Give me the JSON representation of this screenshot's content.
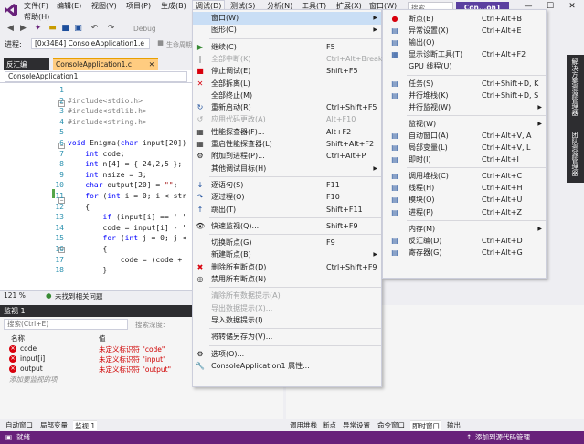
{
  "menubar": {
    "items": [
      {
        "label": "文件(F)"
      },
      {
        "label": "编辑(E)"
      },
      {
        "label": "视图(V)"
      },
      {
        "label": "项目(P)"
      },
      {
        "label": "生成(B)"
      },
      {
        "label": "调试(D)"
      },
      {
        "label": "测试(S)"
      },
      {
        "label": "分析(N)"
      },
      {
        "label": "工具(T)"
      },
      {
        "label": "扩展(X)"
      },
      {
        "label": "窗口(W)"
      }
    ],
    "help": "帮助(H)",
    "search_placeholder": "搜索...",
    "project_badge": "Con...on1"
  },
  "toolbar": {
    "debug_label": "Debug",
    "process_label": "进程:",
    "process_value": "[0x34E4] ConsoleApplication1.e",
    "lifecycle_label": "生命周期"
  },
  "editor": {
    "tab_inactive": "反汇编",
    "tab_active": "ConsoleApplication1.c",
    "scope": "ConsoleApplication1",
    "lines": [
      {
        "n": "1",
        "t": ""
      },
      {
        "n": "2",
        "t": "#include<stdio.h>"
      },
      {
        "n": "3",
        "t": "#include<stdlib.h>"
      },
      {
        "n": "4",
        "t": "#include<string.h>"
      },
      {
        "n": "5",
        "t": ""
      },
      {
        "n": "6",
        "t": "void Enigma(char input[20])"
      },
      {
        "n": "7",
        "t": "    int code;"
      },
      {
        "n": "8",
        "t": "    int n[4] = { 24,2,5 };"
      },
      {
        "n": "9",
        "t": "    int nsize = 3;"
      },
      {
        "n": "10",
        "t": "    char output[20] = \"\";"
      },
      {
        "n": "11",
        "t": "    for (int i = 0; i < str"
      },
      {
        "n": "12",
        "t": "    {"
      },
      {
        "n": "13",
        "t": "        if (input[i] == ' '"
      },
      {
        "n": "14",
        "t": "        code = input[i] - '"
      },
      {
        "n": "15",
        "t": "        for (int j = 0; j <"
      },
      {
        "n": "16",
        "t": "        {"
      },
      {
        "n": "17",
        "t": "            code = (code +"
      },
      {
        "n": "18",
        "t": "        }"
      }
    ],
    "zoom": "121 %",
    "issues": "未找到相关问题"
  },
  "locals": {
    "title": "监视 1",
    "search_placeholder": "搜索(Ctrl+E)",
    "search_depth_label": "搜索深度:",
    "col_name": "名称",
    "col_value": "值",
    "rows": [
      {
        "name": "code",
        "value": "未定义标识符 \"code\""
      },
      {
        "name": "input[i]",
        "value": "未定义标识符 \"input\""
      },
      {
        "name": "output",
        "value": "未定义标识符 \"output\""
      }
    ],
    "add_watch": "添加要监视的项"
  },
  "bottom_tabs_left": [
    "自动窗口",
    "局部变量",
    "监视 1"
  ],
  "bottom_tabs_right": [
    "调用堆栈",
    "断点",
    "异常设置",
    "命令窗口",
    "即时窗口",
    "输出"
  ],
  "status": {
    "left": "就绪",
    "right": "添加到源代码管理"
  },
  "right_tabs": [
    "解决方案资源管理器",
    "团队资源管理器"
  ],
  "debug_menu": {
    "items": [
      {
        "icon": "",
        "label": "窗口(W)",
        "shortcut": "",
        "arrow": true,
        "disabled": false,
        "highlight": true
      },
      {
        "icon": "",
        "label": "图形(C)",
        "shortcut": "",
        "arrow": true,
        "disabled": false
      },
      {
        "sep": true
      },
      {
        "icon": "▶",
        "label": "继续(C)",
        "shortcut": "F5",
        "disabled": false
      },
      {
        "icon": "‖",
        "label": "全部中断(K)",
        "shortcut": "Ctrl+Alt+Break",
        "disabled": true
      },
      {
        "icon": "■",
        "label": "停止调试(E)",
        "shortcut": "Shift+F5",
        "disabled": false
      },
      {
        "icon": "✕",
        "label": "全部拆离(L)",
        "shortcut": "",
        "disabled": false
      },
      {
        "icon": "",
        "label": "全部终止(M)",
        "shortcut": "",
        "disabled": false
      },
      {
        "icon": "↻",
        "label": "重新启动(R)",
        "shortcut": "Ctrl+Shift+F5",
        "disabled": false
      },
      {
        "icon": "↺",
        "label": "应用代码更改(A)",
        "shortcut": "Alt+F10",
        "disabled": true
      },
      {
        "icon": "▦",
        "label": "性能探查器(F)...",
        "shortcut": "Alt+F2",
        "disabled": false
      },
      {
        "icon": "▦",
        "label": "重启性能探查器(L)",
        "shortcut": "Shift+Alt+F2",
        "disabled": false
      },
      {
        "icon": "⚙",
        "label": "附加到进程(P)...",
        "shortcut": "Ctrl+Alt+P",
        "disabled": false
      },
      {
        "icon": "",
        "label": "其他调试目标(H)",
        "shortcut": "",
        "arrow": true,
        "disabled": false
      },
      {
        "sep": true
      },
      {
        "icon": "↓",
        "label": "逐语句(S)",
        "shortcut": "F11",
        "disabled": false
      },
      {
        "icon": "↷",
        "label": "逐过程(O)",
        "shortcut": "F10",
        "disabled": false
      },
      {
        "icon": "↑",
        "label": "跳出(T)",
        "shortcut": "Shift+F11",
        "disabled": false
      },
      {
        "sep": true
      },
      {
        "icon": "👁",
        "label": "快速监视(Q)...",
        "shortcut": "Shift+F9",
        "disabled": false
      },
      {
        "sep": true
      },
      {
        "icon": "",
        "label": "切换断点(G)",
        "shortcut": "F9",
        "disabled": false
      },
      {
        "icon": "",
        "label": "新建断点(B)",
        "shortcut": "",
        "arrow": true,
        "disabled": false
      },
      {
        "icon": "✖",
        "label": "删除所有断点(D)",
        "shortcut": "Ctrl+Shift+F9",
        "disabled": false
      },
      {
        "icon": "◎",
        "label": "禁用所有断点(N)",
        "shortcut": "",
        "disabled": false
      },
      {
        "sep": true
      },
      {
        "icon": "",
        "label": "清除所有数据提示(A)",
        "shortcut": "",
        "disabled": true
      },
      {
        "icon": "",
        "label": "导出数据提示(X)...",
        "shortcut": "",
        "disabled": true
      },
      {
        "icon": "",
        "label": "导入数据提示(I)...",
        "shortcut": "",
        "disabled": false
      },
      {
        "sep": true
      },
      {
        "icon": "",
        "label": "将转储另存为(V)...",
        "shortcut": "",
        "disabled": false
      },
      {
        "sep": true
      },
      {
        "icon": "⚙",
        "label": "选项(O)...",
        "shortcut": "",
        "disabled": false
      },
      {
        "icon": "🔧",
        "label": "ConsoleApplication1 属性...",
        "shortcut": "",
        "disabled": false
      }
    ]
  },
  "window_menu": {
    "items": [
      {
        "icon": "●",
        "label": "断点(B)",
        "shortcut": "Ctrl+Alt+B",
        "color": "#d8000c"
      },
      {
        "icon": "▤",
        "label": "异常设置(X)",
        "shortcut": "Ctrl+Alt+E"
      },
      {
        "icon": "▤",
        "label": "输出(O)",
        "shortcut": ""
      },
      {
        "icon": "▦",
        "label": "显示诊断工具(T)",
        "shortcut": "Ctrl+Alt+F2"
      },
      {
        "icon": "",
        "label": "GPU 线程(U)",
        "shortcut": ""
      },
      {
        "sep": true
      },
      {
        "icon": "▤",
        "label": "任务(S)",
        "shortcut": "Ctrl+Shift+D, K"
      },
      {
        "icon": "▤",
        "label": "并行堆栈(K)",
        "shortcut": "Ctrl+Shift+D, S"
      },
      {
        "icon": "",
        "label": "并行监视(W)",
        "shortcut": "",
        "arrow": true
      },
      {
        "sep": true
      },
      {
        "icon": "",
        "label": "监视(W)",
        "shortcut": "",
        "arrow": true
      },
      {
        "icon": "▤",
        "label": "自动窗口(A)",
        "shortcut": "Ctrl+Alt+V, A"
      },
      {
        "icon": "▤",
        "label": "局部变量(L)",
        "shortcut": "Ctrl+Alt+V, L"
      },
      {
        "icon": "▤",
        "label": "即时(I)",
        "shortcut": "Ctrl+Alt+I"
      },
      {
        "sep": true
      },
      {
        "icon": "▤",
        "label": "调用堆栈(C)",
        "shortcut": "Ctrl+Alt+C"
      },
      {
        "icon": "▤",
        "label": "线程(H)",
        "shortcut": "Ctrl+Alt+H"
      },
      {
        "icon": "▤",
        "label": "模块(O)",
        "shortcut": "Ctrl+Alt+U"
      },
      {
        "icon": "▤",
        "label": "进程(P)",
        "shortcut": "Ctrl+Alt+Z"
      },
      {
        "sep": true
      },
      {
        "icon": "",
        "label": "内存(M)",
        "shortcut": "",
        "arrow": true
      },
      {
        "icon": "▤",
        "label": "反汇编(D)",
        "shortcut": "Ctrl+Alt+D"
      },
      {
        "icon": "▤",
        "label": "寄存器(G)",
        "shortcut": "Ctrl+Alt+G"
      }
    ]
  },
  "colors": {
    "accent": "#68217a",
    "highlight": "#c9def5",
    "error": "#d8000c"
  }
}
